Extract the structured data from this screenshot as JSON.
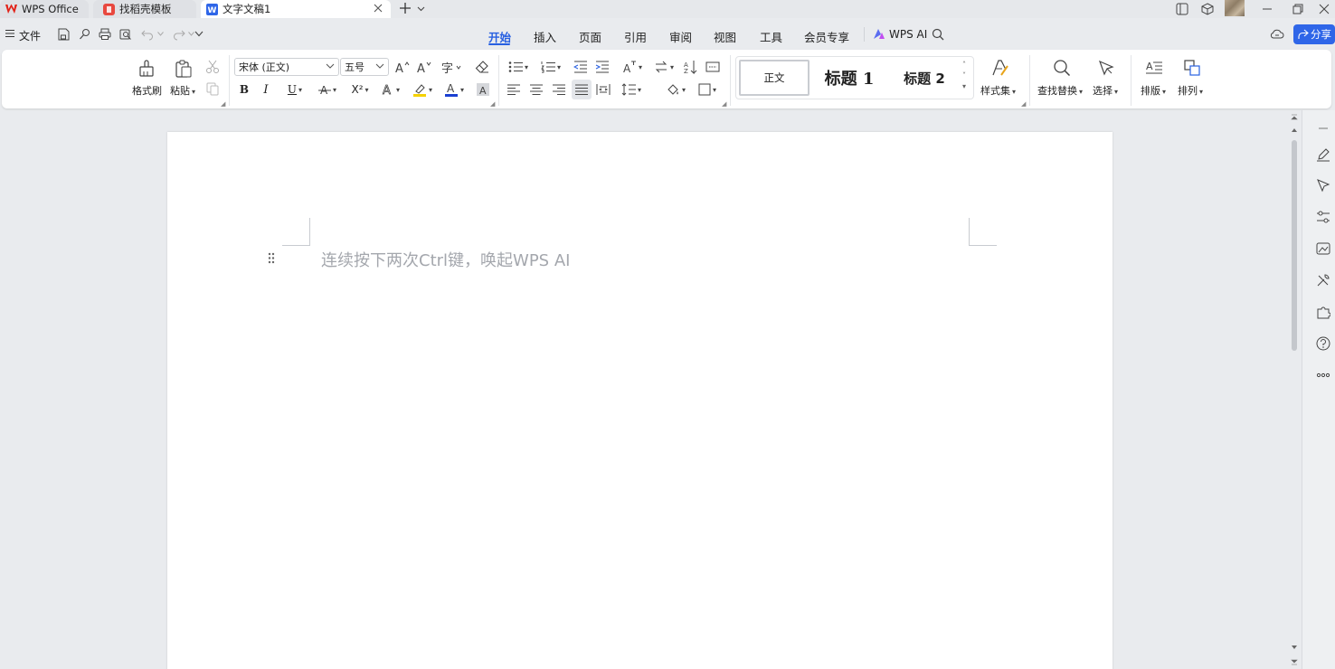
{
  "tabs": [
    {
      "label": "WPS Office",
      "icon": "wps-logo-icon"
    },
    {
      "label": "找稻壳模板",
      "icon": "docer-icon"
    },
    {
      "label": "文字文稿1",
      "icon": "writer-doc-icon"
    }
  ],
  "menu": {
    "file": "文件",
    "tabs": [
      "开始",
      "插入",
      "页面",
      "引用",
      "审阅",
      "视图",
      "工具",
      "会员专享"
    ],
    "active_tab": "开始",
    "wps_ai": "WPS AI",
    "share": "分享"
  },
  "ribbon": {
    "format_painter": "格式刷",
    "paste": "粘贴",
    "font_name": "宋体 (正文)",
    "font_size": "五号",
    "bold": "B",
    "italic": "I",
    "underline": "U",
    "superscript": "X²",
    "styles": {
      "normal": "正文",
      "heading1": "标题 1",
      "heading2": "标题 2"
    },
    "style_set": "样式集",
    "find_replace": "查找替换",
    "select": "选择",
    "layout": "排版",
    "arrange": "排列"
  },
  "document": {
    "placeholder": "连续按下两次Ctrl键，唤起WPS AI"
  },
  "colors": {
    "accent": "#2860e1",
    "wps_red": "#e2231a",
    "highlight": "#f5d100",
    "font_color": "#1a3fd1"
  }
}
